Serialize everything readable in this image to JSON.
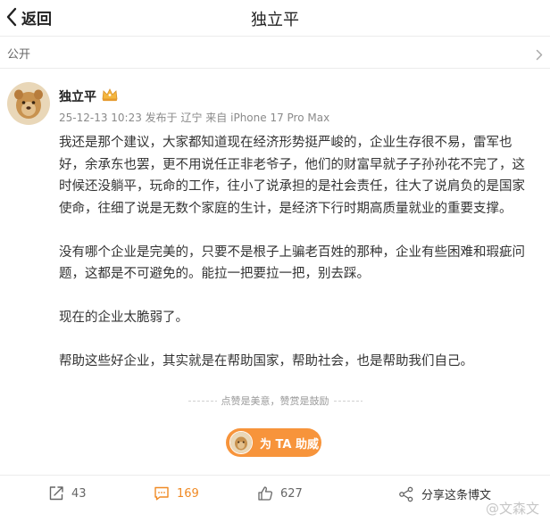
{
  "header": {
    "back_label": "返回",
    "title": "独立平"
  },
  "visibility": "公开",
  "post": {
    "author": "独立平",
    "meta": "25-12-13 10:23  发布于 辽宁  来自 iPhone 17 Pro Max",
    "paragraphs": [
      "我还是那个建议，大家都知道现在经济形势挺严峻的，企业生存很不易，雷军也\n好，余承东也罢，更不用说任正非老爷子，他们的财富早就子子孙孙花不完了，这\n时候还没躺平，玩命的工作，往小了说承担的是社会责任，往大了说肩负的是国家\n使命，往细了说是无数个家庭的生计，是经济下行时期高质量就业的重要支撑。",
      "没有哪个企业是完美的，只要不是根子上骗老百姓的那种，企业有些困难和瑕疵问\n题，这都是不可避免的。能拉一把要拉一把，别去踩。",
      "现在的企业太脆弱了。",
      "帮助这些好企业，其实就是在帮助国家，帮助社会，也是帮助我们自己。"
    ],
    "reward_tip": "点赞是美意，赞赏是鼓励",
    "reward_button": "为 TA 助威"
  },
  "footer": {
    "repost_count": "43",
    "comment_count": "169",
    "like_count": "627",
    "share_label": "分享这条博文"
  },
  "watermark": "@文森文",
  "colors": {
    "accent_orange": "#f7943b",
    "comment_orange": "#f08a24"
  },
  "icons": {
    "back": "chevron-left-icon",
    "badge": "crown-badge-icon",
    "repost": "repost-icon",
    "comment": "comment-icon",
    "like": "thumbs-up-icon",
    "share": "share-icon"
  }
}
